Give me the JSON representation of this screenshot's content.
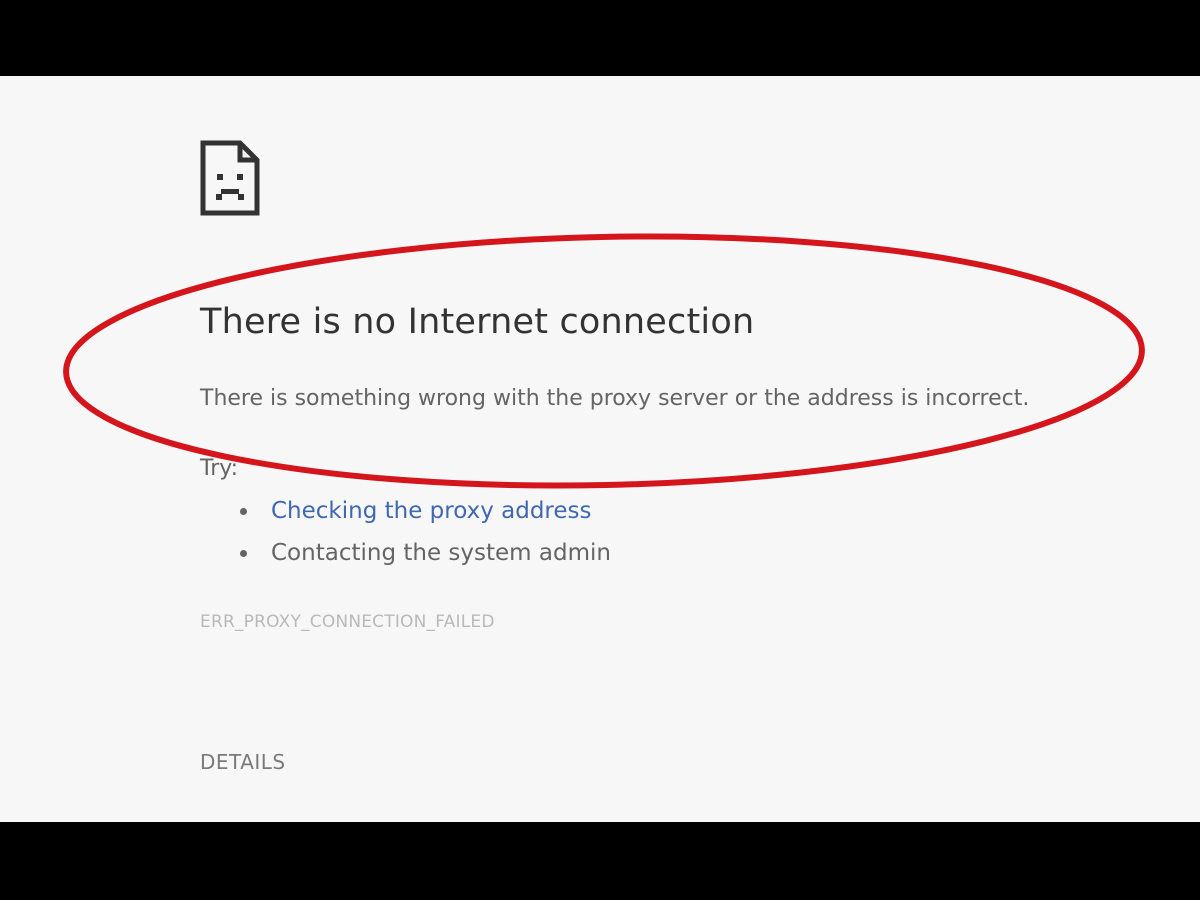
{
  "error_page": {
    "title": "There is no Internet connection",
    "message": "There is something wrong with the proxy server or the address is incorrect.",
    "try_label": "Try:",
    "suggestions": [
      {
        "label": "Checking the proxy address",
        "is_link": true
      },
      {
        "label": "Contacting the system admin",
        "is_link": false
      }
    ],
    "error_code": "ERR_PROXY_CONNECTION_FAILED",
    "details_label": "DETAILS",
    "icon": "sad-page-icon"
  },
  "annotation": {
    "shape": "ellipse",
    "color": "#d4161c",
    "encircles": "title and message"
  },
  "colors": {
    "letterbox": "#000000",
    "page_background": "#f7f7f7",
    "link": "#3f68b1",
    "text": "#646464",
    "error_code": "#b9b9b9"
  }
}
